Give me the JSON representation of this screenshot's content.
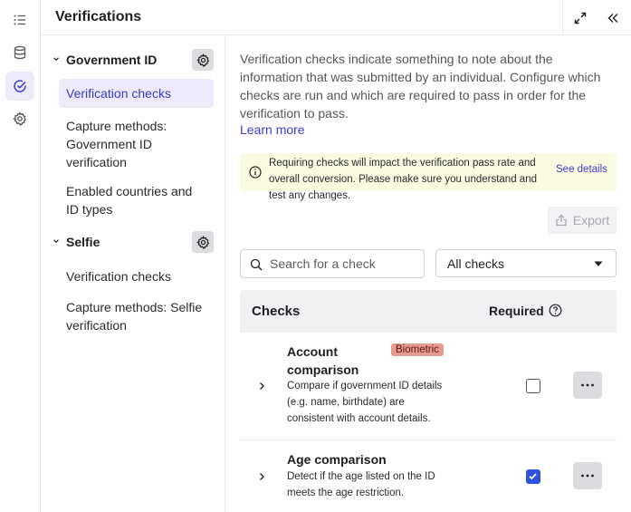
{
  "rail": {
    "items": [
      {
        "icon": "list-icon"
      },
      {
        "icon": "database-icon"
      },
      {
        "icon": "check-circle-icon",
        "active": true
      },
      {
        "icon": "gear-icon"
      }
    ]
  },
  "header": {
    "title": "Verifications",
    "expand_icon": "expand-icon",
    "collapse_icon": "double-chevron-left-icon"
  },
  "sidebar": {
    "groups": [
      {
        "label": "Government ID",
        "items": [
          {
            "label": "Verification checks",
            "active": true
          },
          {
            "label": "Capture methods: Government ID verification"
          },
          {
            "label": "Enabled countries and ID types"
          }
        ]
      },
      {
        "label": "Selfie",
        "items": [
          {
            "label": "Verification checks"
          },
          {
            "label": "Capture methods: Selfie verification"
          }
        ]
      }
    ]
  },
  "main": {
    "intro": "Verification checks indicate something to note about the information that was submitted by an individual. Configure which checks are run and which are required to pass in order for the verification to pass.",
    "learn_more": "Learn more",
    "alert": {
      "text": "Requiring checks will impact the verification pass rate and overall conversion. Please make sure you understand and test any changes.",
      "link": "See details"
    },
    "export_label": "Export",
    "search": {
      "placeholder": "Search for a check",
      "value": ""
    },
    "filter": {
      "selected": "All checks"
    },
    "table": {
      "col_checks": "Checks",
      "col_required": "Required",
      "rows": [
        {
          "title": "Account comparison",
          "badge": "Biometric",
          "desc": "Compare if government ID details (e.g. name, birthdate) are consistent with account details.",
          "required": false
        },
        {
          "title": "Age comparison",
          "badge": "",
          "desc": "Detect if the age listed on the ID meets the age restriction.",
          "required": true
        }
      ]
    }
  },
  "colors": {
    "accent": "#3b3bd4",
    "active_bg": "#ecebfb",
    "alert_bg": "#fafbe1",
    "badge_bg": "#e89a8e",
    "checkbox_checked": "#2e52e0"
  }
}
